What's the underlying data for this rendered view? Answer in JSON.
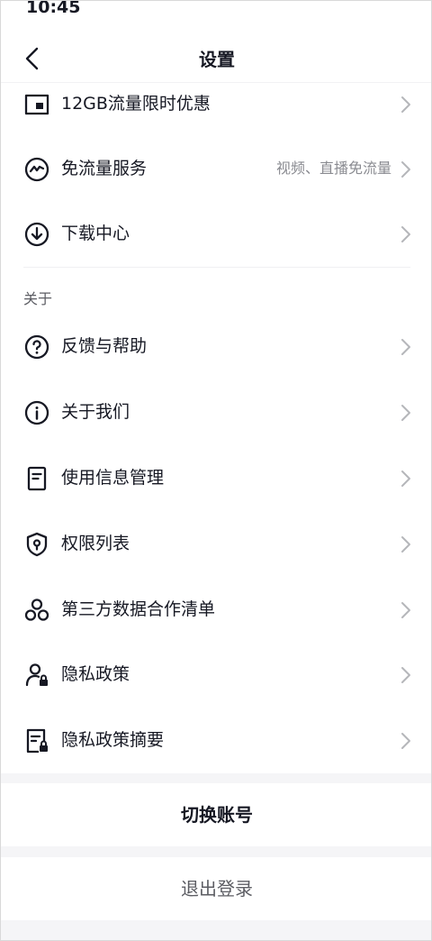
{
  "status_bar": {
    "time": "10:45"
  },
  "header": {
    "title": "设置"
  },
  "rows_top": [
    {
      "label": "12GB流量限时优惠",
      "value": ""
    },
    {
      "label": "免流量服务",
      "value": "视频、直播免流量"
    },
    {
      "label": "下载中心",
      "value": ""
    }
  ],
  "section_about": {
    "title": "关于",
    "items": [
      {
        "label": "反馈与帮助"
      },
      {
        "label": "关于我们"
      },
      {
        "label": "使用信息管理"
      },
      {
        "label": "权限列表"
      },
      {
        "label": "第三方数据合作清单"
      },
      {
        "label": "隐私政策"
      },
      {
        "label": "隐私政策摘要"
      }
    ]
  },
  "actions": {
    "switch_account": "切换账号",
    "logout": "退出登录"
  },
  "icons": {
    "back": "chevron-left-icon",
    "sim": "sim-card-icon",
    "free_data": "flow-icon",
    "download": "download-icon",
    "feedback": "help-circle-icon",
    "about": "info-icon",
    "usage": "document-icon",
    "permission": "shield-icon",
    "third_party": "nodes-icon",
    "privacy": "user-lock-icon",
    "privacy_summary": "doc-lock-icon",
    "chevron": "chevron-right-icon"
  },
  "colors": {
    "text": "#161823",
    "secondary": "#8a8b91",
    "separator": "#f5f5f7"
  }
}
